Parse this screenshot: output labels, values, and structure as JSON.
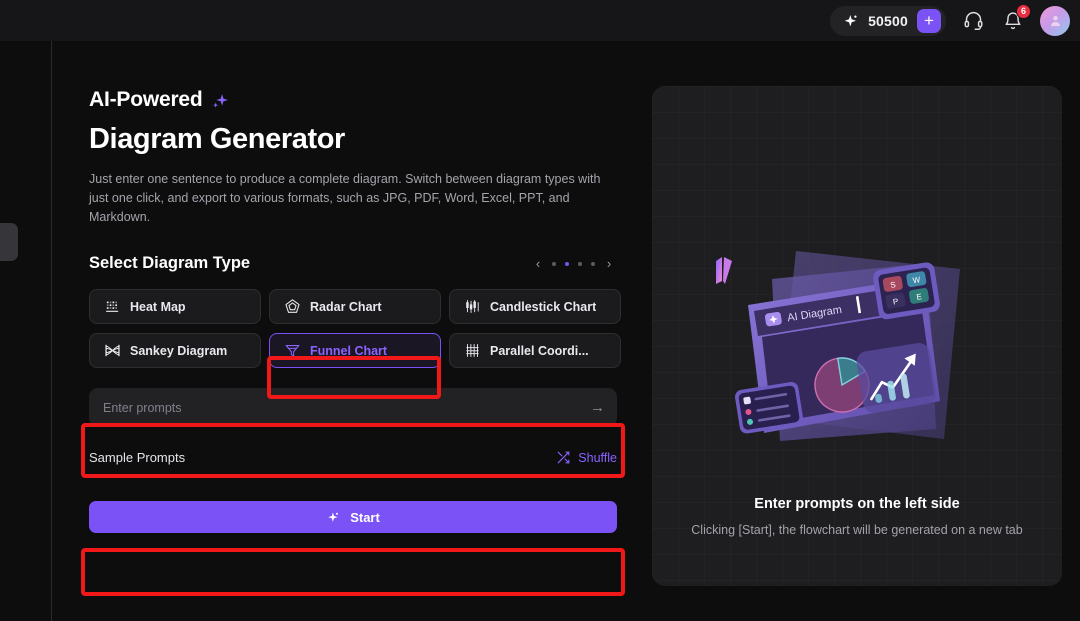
{
  "topbar": {
    "credit_icon": "sparkle-icon",
    "credit_value": "50500",
    "add_credit_label": "+",
    "support_icon": "headset-icon",
    "notification_icon": "bell-icon",
    "notification_count": "6",
    "avatar_icon": "user-avatar"
  },
  "hero": {
    "eyebrow": "AI-Powered",
    "eyebrow_icon": "sparkle-icon",
    "title": "Diagram Generator",
    "description": "Just enter one sentence to produce a complete diagram. Switch between diagram types with just one click, and export to various formats, such as JPG, PDF, Word, Excel, PPT, and Markdown."
  },
  "selector": {
    "title": "Select Diagram Type",
    "prev_arrow": "‹",
    "next_arrow": "›",
    "dots": 4,
    "active_dot": 1,
    "types": [
      {
        "label": "Heat Map",
        "icon": "heat-map-icon",
        "selected": false
      },
      {
        "label": "Radar Chart",
        "icon": "radar-chart-icon",
        "selected": false
      },
      {
        "label": "Candlestick Chart",
        "icon": "candlestick-icon",
        "selected": false
      },
      {
        "label": "Sankey Diagram",
        "icon": "sankey-icon",
        "selected": false
      },
      {
        "label": "Funnel Chart",
        "icon": "funnel-icon",
        "selected": true
      },
      {
        "label": "Parallel Coordi...",
        "icon": "parallel-coords-icon",
        "selected": false
      }
    ]
  },
  "prompt": {
    "placeholder": "Enter prompts",
    "value": "",
    "send_icon": "arrow-right-icon"
  },
  "samples": {
    "title": "Sample Prompts",
    "shuffle_label": "Shuffle",
    "shuffle_icon": "shuffle-icon"
  },
  "start": {
    "label": "Start",
    "icon": "sparkle-icon"
  },
  "preview": {
    "heading": "Enter prompts on the left side",
    "subtext": "Clicking [Start], the flowchart will be generated on a new tab",
    "illustration": {
      "window_title": "AI Diagram",
      "export_badges": [
        "S",
        "W",
        "P",
        "E"
      ]
    }
  },
  "colors": {
    "accent": "#7b52f5",
    "accent_text": "#8b63ff",
    "annotation": "#f01818",
    "page_bg": "#0d0d0e",
    "topbar_bg": "#161618",
    "panel_bg": "#1e1e20",
    "badge_red": "#ec2d3f"
  }
}
